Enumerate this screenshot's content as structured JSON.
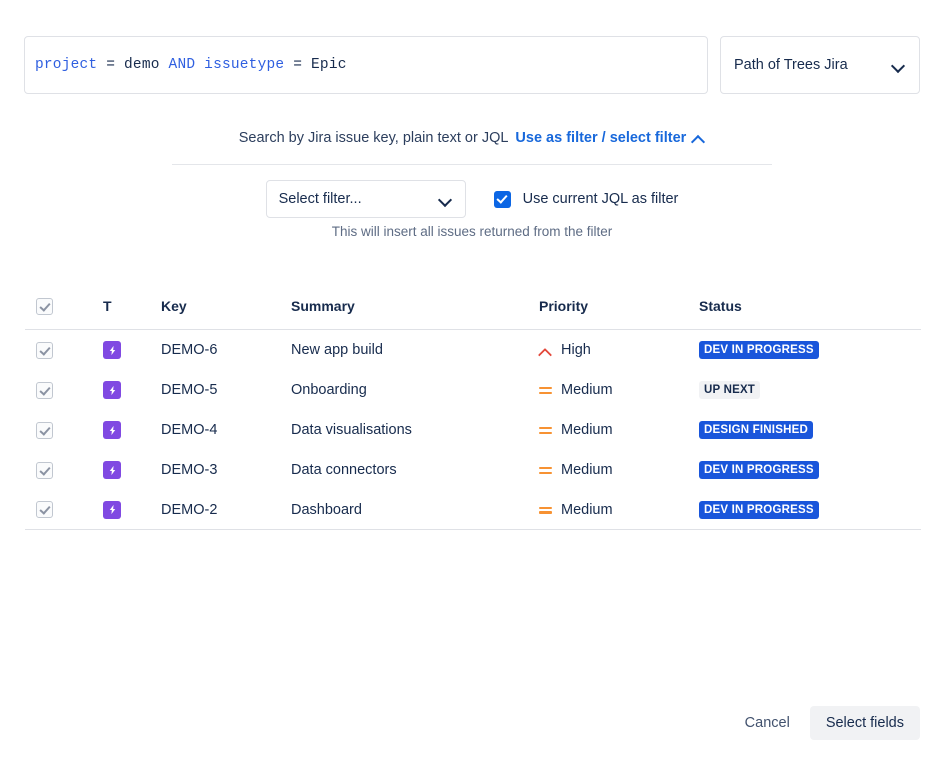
{
  "jql": {
    "tokens": [
      {
        "text": "project",
        "kind": "keyword"
      },
      {
        "text": " = ",
        "kind": "operator"
      },
      {
        "text": "demo",
        "kind": "value"
      },
      {
        "text": " ",
        "kind": "operator"
      },
      {
        "text": "AND",
        "kind": "keyword"
      },
      {
        "text": " ",
        "kind": "operator"
      },
      {
        "text": "issuetype",
        "kind": "keyword"
      },
      {
        "text": " = ",
        "kind": "operator"
      },
      {
        "text": "Epic",
        "kind": "value"
      }
    ],
    "raw": "project = demo AND issuetype = Epic"
  },
  "site_select": {
    "value": "Path of Trees Jira",
    "icon": "chevron-down-icon"
  },
  "hint": {
    "text": "Search by Jira issue key, plain text or JQL",
    "link": "Use as filter / select filter",
    "link_icon": "chevron-up-icon"
  },
  "filter": {
    "select_value": "Select filter...",
    "select_icon": "chevron-down-icon",
    "checkbox_label": "Use current JQL as filter",
    "checkbox_checked": true,
    "helper": "This will insert all issues returned from the filter"
  },
  "table": {
    "headers": {
      "select_all": "",
      "type": "T",
      "key": "Key",
      "summary": "Summary",
      "priority": "Priority",
      "status": "Status"
    },
    "rows": [
      {
        "checked": true,
        "type_icon": "epic-icon",
        "key": "DEMO-6",
        "summary": "New app build",
        "priority": "High",
        "priority_icon": "priority-high-icon",
        "status": "DEV IN PROGRESS",
        "status_style": "blue"
      },
      {
        "checked": true,
        "type_icon": "epic-icon",
        "key": "DEMO-5",
        "summary": "Onboarding",
        "priority": "Medium",
        "priority_icon": "priority-medium-icon",
        "status": "UP NEXT",
        "status_style": "grey"
      },
      {
        "checked": true,
        "type_icon": "epic-icon",
        "key": "DEMO-4",
        "summary": "Data visualisations",
        "priority": "Medium",
        "priority_icon": "priority-medium-icon",
        "status": "DESIGN FINISHED",
        "status_style": "blue"
      },
      {
        "checked": true,
        "type_icon": "epic-icon",
        "key": "DEMO-3",
        "summary": "Data connectors",
        "priority": "Medium",
        "priority_icon": "priority-medium-icon",
        "status": "DEV IN PROGRESS",
        "status_style": "blue"
      },
      {
        "checked": true,
        "type_icon": "epic-icon",
        "key": "DEMO-2",
        "summary": "Dashboard",
        "priority": "Medium",
        "priority_icon": "priority-medium-icon",
        "status": "DEV IN PROGRESS",
        "status_style": "blue"
      }
    ]
  },
  "footer": {
    "cancel": "Cancel",
    "primary": "Select fields"
  },
  "colors": {
    "link": "#1868DB",
    "checkbox_checked": "#0C66E4",
    "epic": "#8049E2",
    "priority_high": "#E3483B",
    "priority_medium": "#F79232",
    "badge_blue": "#1A56DB",
    "badge_grey": "#F1F2F4",
    "jql_keyword": "#2F5FE0",
    "border": "#DFE1E6"
  }
}
